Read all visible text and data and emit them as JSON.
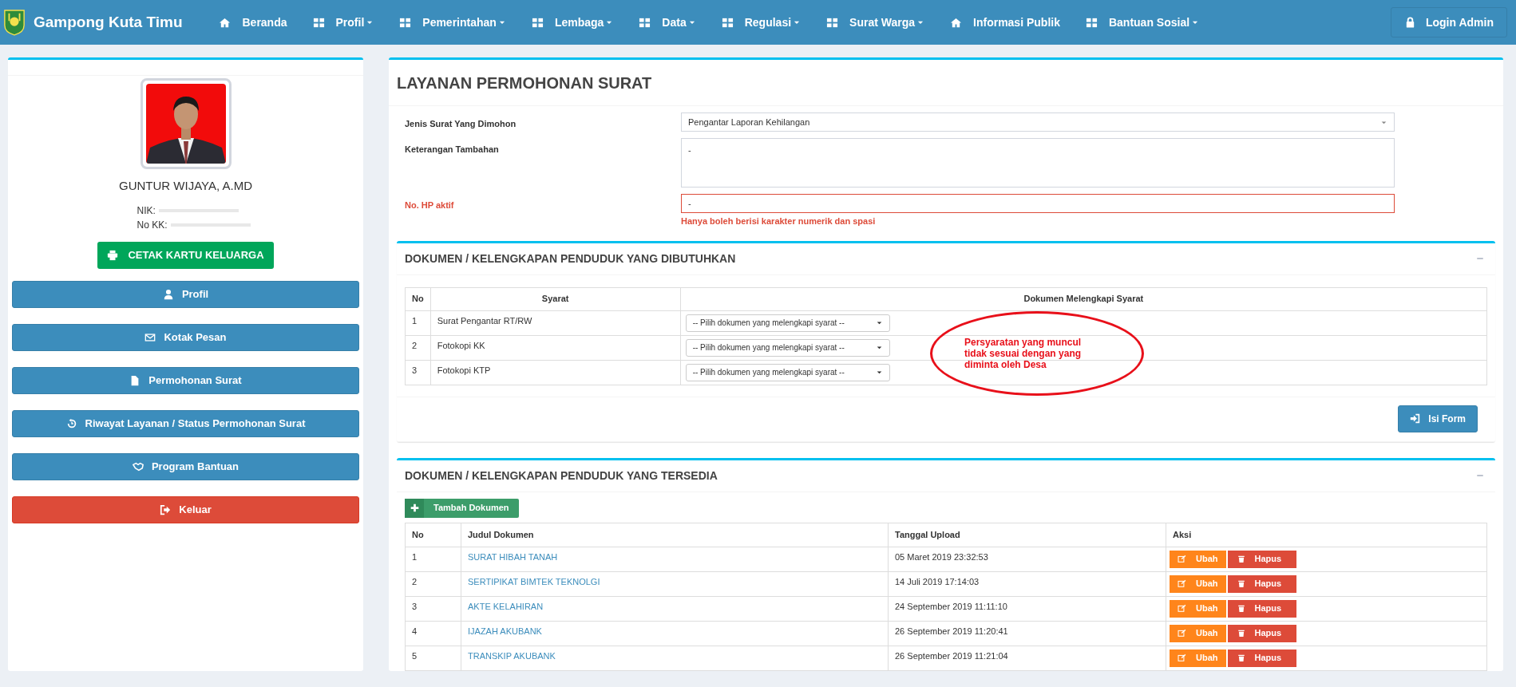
{
  "navbar": {
    "brand": "Gampong Kuta Timu",
    "menu": [
      {
        "label": "Beranda",
        "dropdown": false
      },
      {
        "label": "Profil",
        "dropdown": true
      },
      {
        "label": "Pemerintahan",
        "dropdown": true
      },
      {
        "label": "Lembaga",
        "dropdown": true
      },
      {
        "label": "Data",
        "dropdown": true
      },
      {
        "label": "Regulasi",
        "dropdown": true
      },
      {
        "label": "Surat Warga",
        "dropdown": true
      },
      {
        "label": "Informasi Publik",
        "dropdown": false
      },
      {
        "label": "Bantuan Sosial",
        "dropdown": true
      }
    ],
    "login": "Login Admin"
  },
  "profile": {
    "name": "GUNTUR WIJAYA, A.MD",
    "nik_label": "NIK:",
    "kk_label": "No KK:",
    "print_button": "CETAK KARTU KELUARGA",
    "menu": [
      {
        "label": "Profil",
        "kind": "primary"
      },
      {
        "label": "Kotak Pesan",
        "kind": "primary"
      },
      {
        "label": "Permohonan Surat",
        "kind": "primary"
      },
      {
        "label": "Riwayat Layanan / Status Permohonan Surat",
        "kind": "primary"
      },
      {
        "label": "Program Bantuan",
        "kind": "primary"
      },
      {
        "label": "Keluar",
        "kind": "danger"
      }
    ]
  },
  "request_form": {
    "title": "LAYANAN PERMOHONAN SURAT",
    "fields": [
      {
        "label": "Jenis Surat Yang Dimohon",
        "kind": "select",
        "value": "Pengantar Laporan Kehilangan",
        "error": false
      },
      {
        "label": "Keterangan Tambahan",
        "kind": "textarea",
        "value": "-",
        "error": false
      },
      {
        "label": "No. HP aktif",
        "kind": "input",
        "value": "-",
        "error": true,
        "error_message": "Hanya boleh berisi karakter numerik dan spasi"
      }
    ]
  },
  "required_documents": {
    "title": "DOKUMEN / KELENGKAPAN PENDUDUK YANG DIBUTUHKAN",
    "columns": [
      "No",
      "Syarat",
      "Dokumen Melengkapi Syarat"
    ],
    "rows": [
      {
        "no": "1",
        "requirement": "Surat Pengantar RT/RW",
        "document": "-- Pilih dokumen yang melengkapi syarat --"
      },
      {
        "no": "2",
        "requirement": "Fotokopi KK",
        "document": "-- Pilih dokumen yang melengkapi syarat --"
      },
      {
        "no": "3",
        "requirement": "Fotokopi KTP",
        "document": "-- Pilih dokumen yang melengkapi syarat --"
      }
    ],
    "annotation_lines": [
      "Persyaratan yang muncul",
      "tidak sesuai dengan yang",
      "diminta oleh Desa"
    ],
    "submit_button": "Isi Form"
  },
  "available_documents": {
    "title": "DOKUMEN / KELENGKAPAN PENDUDUK YANG TERSEDIA",
    "add_button": "Tambah Dokumen",
    "columns": [
      "No",
      "Judul Dokumen",
      "Tanggal Upload",
      "Aksi"
    ],
    "rows": [
      {
        "no": "1",
        "title": "SURAT HIBAH TANAH",
        "date": "05 Maret 2019 23:32:53",
        "edit": "Ubah",
        "delete": "Hapus"
      },
      {
        "no": "2",
        "title": "SERTIPIKAT BIMTEK TEKNOLGI",
        "date": "14 Juli 2019 17:14:03",
        "edit": "Ubah",
        "delete": "Hapus"
      },
      {
        "no": "3",
        "title": "AKTE KELAHIRAN",
        "date": "24 September 2019 11:11:10",
        "edit": "Ubah",
        "delete": "Hapus"
      },
      {
        "no": "4",
        "title": "IJAZAH AKUBANK",
        "date": "26 September 2019 11:20:41",
        "edit": "Ubah",
        "delete": "Hapus"
      },
      {
        "no": "5",
        "title": "TRANSKIP AKUBANK",
        "date": "26 September 2019 11:21:04",
        "edit": "Ubah",
        "delete": "Hapus"
      }
    ]
  }
}
